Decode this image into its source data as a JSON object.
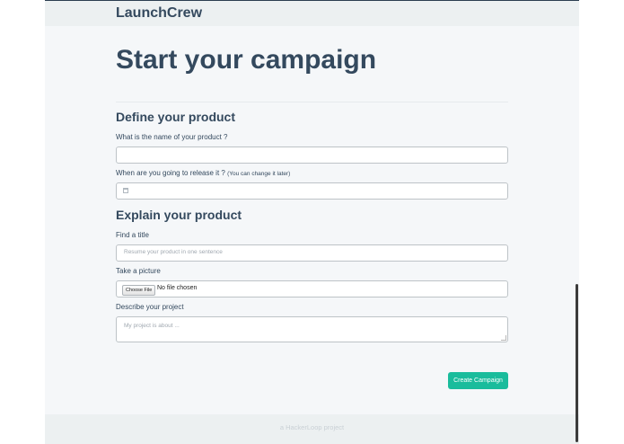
{
  "navbar": {
    "brand": "LaunchCrew"
  },
  "page": {
    "title": "Start your campaign"
  },
  "section_define": {
    "title": "Define your product",
    "name_label": "What is the name of your product ?",
    "name_value": "",
    "release_label": "When are you going to release it ?",
    "release_hint": "(You can change it later)",
    "release_value": ""
  },
  "section_explain": {
    "title": "Explain your product",
    "title_label": "Find a title",
    "title_placeholder": "Resume your product in one sentence",
    "picture_label": "Take a picture",
    "choose_file": "Choose File",
    "file_status": "No file chosen",
    "describe_label": "Describe your project",
    "describe_placeholder": "My project is about ..."
  },
  "actions": {
    "submit": "Create Campaign"
  },
  "footer": {
    "text": "a HackerLoop project"
  },
  "icons": {
    "calendar": "calendar-icon"
  },
  "colors": {
    "accent": "#1abc9c",
    "text": "#34495e",
    "background": "#f5f7f9"
  }
}
